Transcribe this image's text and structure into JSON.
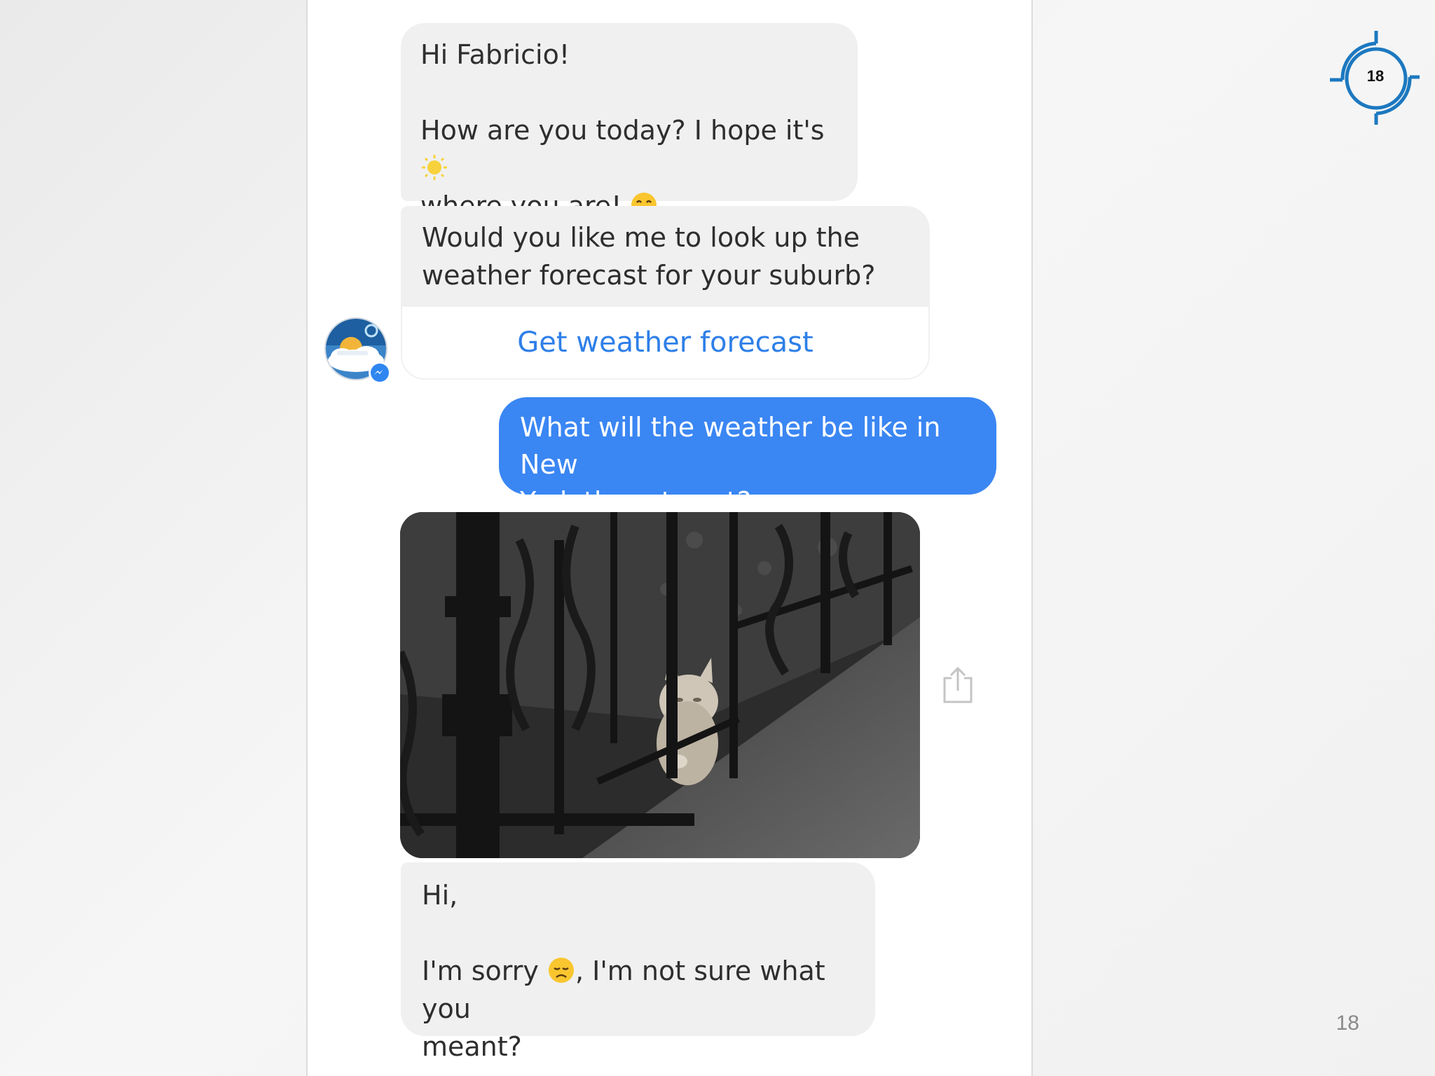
{
  "messages": {
    "greeting": {
      "line1": "Hi Fabricio!",
      "line2_a": "How are you today? I hope it's",
      "line3_a": "where you are!"
    },
    "prompt": {
      "text": "Would you like me to look up the\nweather forecast for your suburb?",
      "button_label": "Get weather forecast"
    },
    "user": {
      "text": "What will the weather be like in New\nYork thurs to sat?"
    },
    "reply": {
      "line1": "Hi,",
      "line2_a": "I'm sorry",
      "line2_b": ", I'm not sure what you",
      "line3": "meant?"
    }
  },
  "icons": {
    "sun": "sun-emoji",
    "grin": "grinning-emoji",
    "sad": "disappointed-emoji",
    "share": "share-icon",
    "messenger": "messenger-badge"
  },
  "colors": {
    "user_bubble": "#3a86f3",
    "bot_bubble": "#f0f0f0",
    "link": "#2e7fe8",
    "badge": "#1c78c0"
  },
  "slide": {
    "badge_number": "18",
    "page_number": "18"
  }
}
